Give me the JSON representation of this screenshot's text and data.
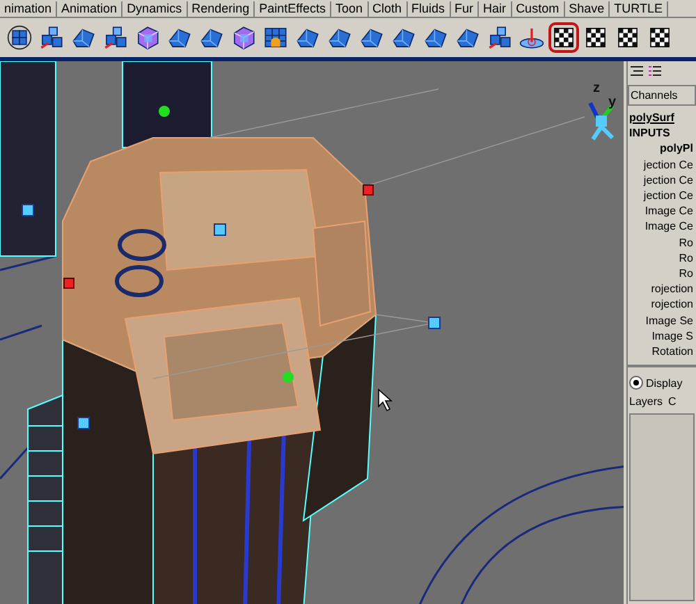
{
  "shelf_tabs": [
    "nimation",
    "Animation",
    "Dynamics",
    "Rendering",
    "PaintEffects",
    "Toon",
    "Cloth",
    "Fluids",
    "Fur",
    "Hair",
    "Custom",
    "Shave",
    "TURTLE"
  ],
  "shelf_icons": [
    {
      "kind": "sphere",
      "selected": false
    },
    {
      "kind": "cubes",
      "selected": false
    },
    {
      "kind": "shape",
      "selected": false
    },
    {
      "kind": "cubes",
      "selected": false
    },
    {
      "kind": "cube",
      "selected": false
    },
    {
      "kind": "shape",
      "selected": false
    },
    {
      "kind": "shape",
      "selected": false
    },
    {
      "kind": "cube",
      "selected": false
    },
    {
      "kind": "grid",
      "selected": false
    },
    {
      "kind": "shape",
      "selected": false
    },
    {
      "kind": "shape",
      "selected": false
    },
    {
      "kind": "shape",
      "selected": false
    },
    {
      "kind": "shape",
      "selected": false
    },
    {
      "kind": "shape",
      "selected": false
    },
    {
      "kind": "shape",
      "selected": false
    },
    {
      "kind": "cubes",
      "selected": false
    },
    {
      "kind": "cone",
      "selected": false
    },
    {
      "kind": "checker",
      "selected": true
    },
    {
      "kind": "checker",
      "selected": false
    },
    {
      "kind": "checker",
      "selected": false
    },
    {
      "kind": "checker",
      "selected": false
    }
  ],
  "view_axes": [
    "z",
    "y"
  ],
  "channel_box": {
    "header": "Channels",
    "node": "polySurf",
    "inputs": "INPUTS",
    "input_node": "polyPl",
    "attributes": [
      "jection Ce",
      "jection Ce",
      "jection Ce",
      "Image Ce",
      "Image Ce",
      "Ro",
      "Ro",
      "Ro",
      "rojection",
      "rojection",
      "Image Se",
      "Image S",
      "Rotation"
    ]
  },
  "display_option": {
    "label": "Display",
    "selected": true
  },
  "layer_tabs": [
    "Layers",
    "C"
  ]
}
